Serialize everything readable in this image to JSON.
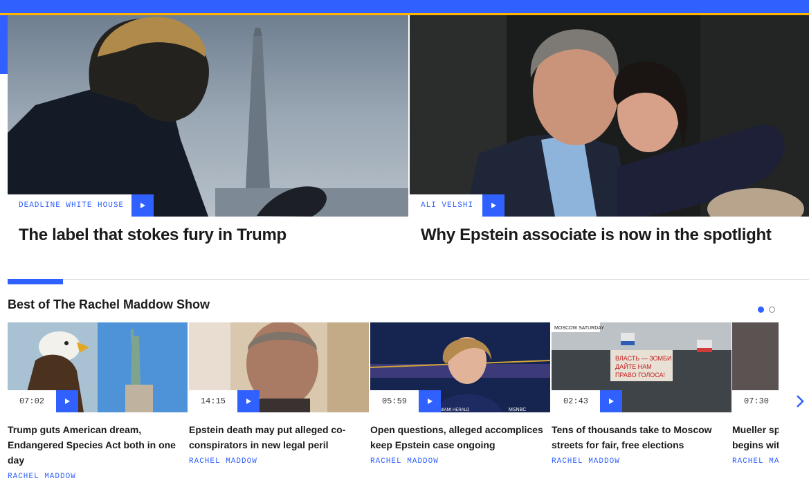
{
  "colors": {
    "brand_blue": "#3061ff",
    "accent_yellow": "#ffb400",
    "text": "#1a1a1a"
  },
  "hero": [
    {
      "show": "DEADLINE WHITE HOUSE",
      "title": "The label that stokes fury in Trump",
      "icon": "play-icon"
    },
    {
      "show": "ALI VELSHI",
      "title": "Why Epstein associate is now in the spotlight",
      "icon": "play-icon"
    }
  ],
  "section": {
    "title": "Best of The Rachel Maddow Show"
  },
  "cards": [
    {
      "duration": "07:02",
      "title_lines": [
        "Trump guts American dream,",
        "Endangered Species Act both in one",
        "day"
      ],
      "author": "RACHEL MADDOW"
    },
    {
      "duration": "14:15",
      "title_lines": [
        "Epstein death may put alleged co-",
        "conspirators in new legal peril"
      ],
      "author": "RACHEL MADDOW"
    },
    {
      "duration": "05:59",
      "title_lines": [
        "Open questions, alleged accomplices",
        "keep Epstein case ongoing"
      ],
      "author": "RACHEL MADDOW"
    },
    {
      "duration": "02:43",
      "title_lines": [
        "Tens of thousands take to Moscow",
        "streets for fair, free elections"
      ],
      "author": "RACHEL MADDOW"
    },
    {
      "duration": "07:30",
      "title_lines": [
        "Mueller sp",
        "begins witl"
      ],
      "author": "RACHEL MA"
    }
  ],
  "thumb_texts": {
    "msnbc": "MSNBC",
    "miami_herald": "MIAMI HERALD",
    "moscow_saturday": "MOSCOW SATURDAY",
    "protest_sign_1": "ВЛАСТЬ — ЗОМБИ",
    "protest_sign_2": "ДАЙТЕ НАМ",
    "protest_sign_3": "ПРАВО ГОЛОСА!"
  }
}
